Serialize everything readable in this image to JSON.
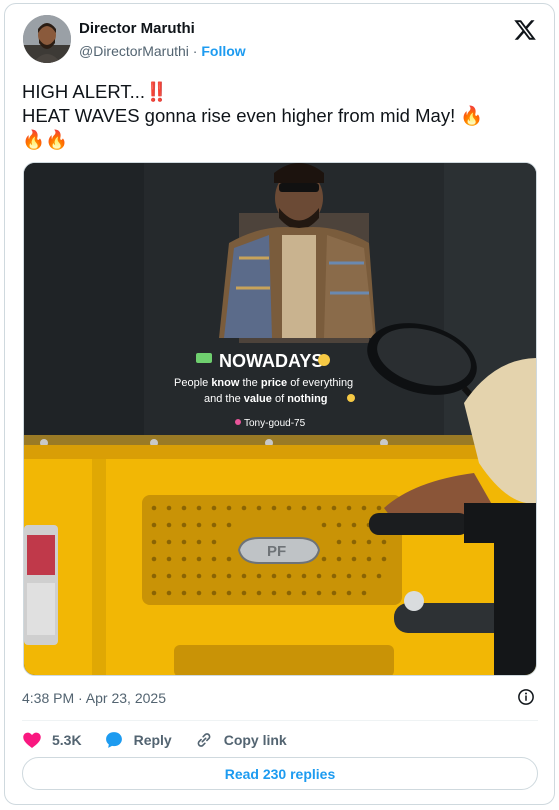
{
  "author": {
    "name": "Director Maruthi",
    "handle": "@DirectorMaruthi",
    "separator": "·",
    "follow_label": "Follow"
  },
  "tweet": {
    "line1": "HIGH ALERT...‼️",
    "line2": "HEAT WAVES gonna rise even higher from mid May! 🔥",
    "line3": "🔥🔥"
  },
  "media": {
    "sticker_title": "NOWADAYS",
    "sticker_line1_a": "People ",
    "sticker_line1_b": "know",
    "sticker_line1_c": " the ",
    "sticker_line1_d": "price",
    "sticker_line1_e": " of everything",
    "sticker_line2_a": "and the ",
    "sticker_line2_b": "value",
    "sticker_line2_c": " of ",
    "sticker_line2_d": "nothing",
    "sticker_credit": "Tony-goud-75",
    "badge_text": "PF"
  },
  "timestamp": "4:38 PM · Apr 23, 2025",
  "actions": {
    "like_count": "5.3K",
    "reply_label": "Reply",
    "copy_label": "Copy link"
  },
  "replies_button_label": "Read 230 replies",
  "colors": {
    "accent": "#1d9bf0",
    "like": "#f91880",
    "text": "#0f1419",
    "muted": "#536471",
    "rickshaw_yellow": "#f2b705"
  },
  "icons": {
    "brand": "x-logo-icon",
    "info": "info-icon",
    "like": "heart-icon",
    "reply": "speech-bubble-icon",
    "copy": "link-icon"
  }
}
